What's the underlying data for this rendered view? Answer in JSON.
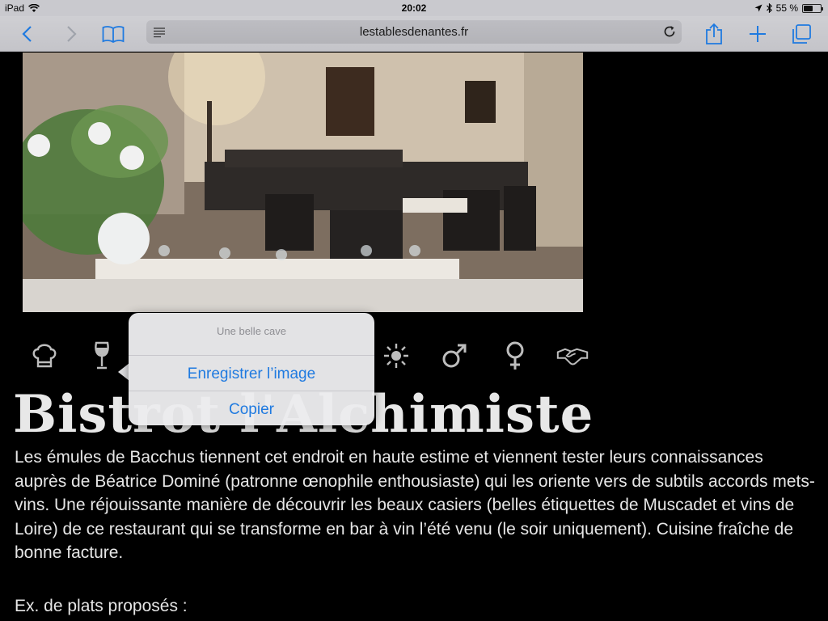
{
  "status_bar": {
    "device": "iPad",
    "time": "20:02",
    "battery_text": "55 %",
    "battery_level": 0.55
  },
  "toolbar": {
    "url": "lestablesdenantes.fr",
    "icons": [
      "back-icon",
      "forward-icon",
      "bookmarks-icon",
      "reader-icon",
      "reload-icon",
      "share-icon",
      "add-icon",
      "tabs-icon"
    ],
    "accent_color": "#1f7ae0"
  },
  "page": {
    "photo_alt": "",
    "amenity_icons": [
      "chef-hat-icon",
      "wine-glass-icon",
      "sun-icon",
      "male-icon",
      "female-icon",
      "handshake-icon"
    ],
    "title": "Bistrot l'Alchimiste",
    "description": "Les émules de Bacchus tiennent cet endroit en haute estime et viennent tester leurs connaissances auprès de Béatrice Dominé (patronne œnophile enthousiaste) qui les oriente vers de subtils accords mets-vins. Une réjouissante manière de découvrir les beaux casiers (belles étiquettes de Muscadet et vins de Loire) de ce restaurant qui se transforme en bar à vin l’été venu (le soir uniquement). Cuisine fraîche de bonne facture.",
    "dishes_label": "Ex. de plats proposés :"
  },
  "popover": {
    "title": "Une belle cave",
    "items": [
      "Enregistrer l’image",
      "Copier"
    ]
  }
}
